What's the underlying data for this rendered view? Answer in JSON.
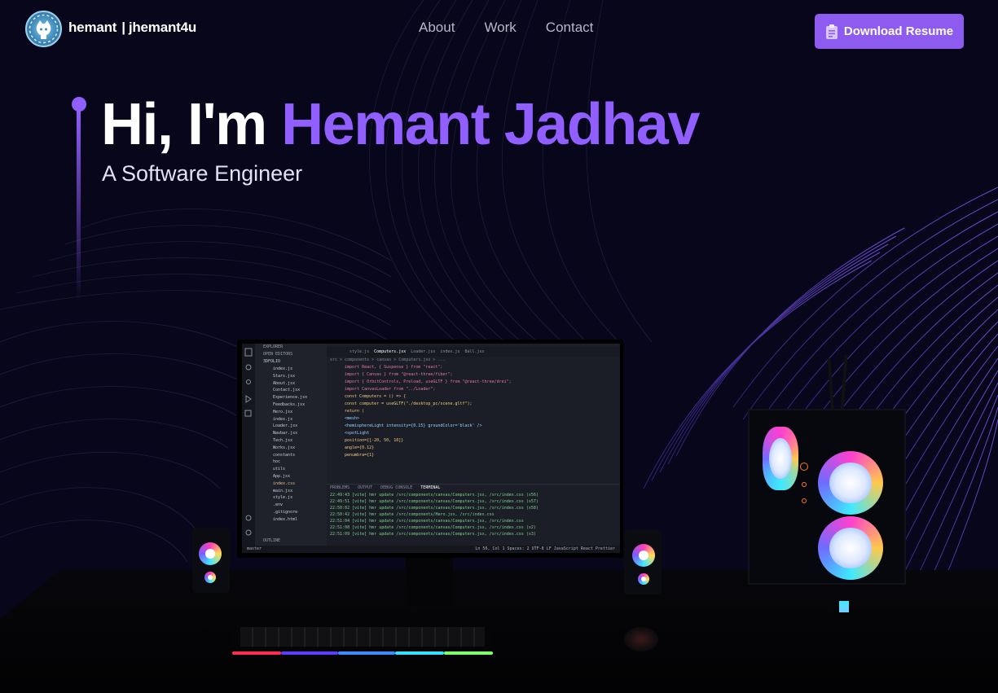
{
  "nav": {
    "brand_name": "hemant",
    "brand_separator": "|",
    "brand_handle": "jhemant4u",
    "links": [
      {
        "label": "About"
      },
      {
        "label": "Work"
      },
      {
        "label": "Contact"
      }
    ],
    "resume_button": "Download Resume",
    "logo_icon": "github-octocat-icon",
    "resume_icon": "clipboard-icon"
  },
  "hero": {
    "greeting": "Hi, I'm",
    "name": "Hemant Jadhav",
    "subtitle": "A Software Engineer"
  },
  "colors": {
    "accent": "#915eff",
    "background": "#07061a",
    "button": "#8d5bf0"
  },
  "monitor_screen": {
    "explorer_title": "EXPLORER",
    "open_editors": "OPEN EDITORS",
    "project": "3DFOLIO",
    "files": [
      "index.js",
      "Stars.jsx",
      "About.jsx",
      "Contact.jsx",
      "Experience.jsx",
      "Feedbacks.jsx",
      "Hero.jsx",
      "index.js",
      "Loader.jsx",
      "Navbar.jsx",
      "Tech.jsx",
      "Works.jsx",
      "constants",
      "hoc",
      "utils",
      "App.jsx",
      "index.css",
      "main.jsx",
      "style.js",
      ".env",
      ".gitignore",
      "index.html"
    ],
    "outline": "OUTLINE",
    "tabs": [
      "style.js",
      "Computers.jsx",
      "Loader.jsx",
      "index.js",
      "Ball.jsx"
    ],
    "breadcrumb": "src > components > canvas > Computers.jsx > ...",
    "code_lines": [
      "import React, { Suspense } from \"react\";",
      "import { Canvas } from \"@react-three/fiber\";",
      "import { OrbitControls, Preload, useGLTF } from \"@react-three/drei\";",
      "",
      "import CanvasLoader from \"../Loader\";",
      "",
      "const Computers = () => {",
      "  const computer = useGLTF(\"./desktop_pc/scene.gltf\");",
      "",
      "  return (",
      "    <mesh>",
      "      <hemisphereLight intensity={0.15} groundColor='black' />",
      "      <spotLight",
      "        position={[-20, 50, 10]}",
      "        angle={0.12}",
      "        penumbra={1}"
    ],
    "panel_tabs": [
      "PROBLEMS",
      "OUTPUT",
      "DEBUG CONSOLE",
      "TERMINAL"
    ],
    "terminal_lines": [
      "22:49:43 [vite] hmr update /src/components/canvas/Computers.jsx, /src/index.css (x56)",
      "22:49:51 [vite] hmr update /src/components/canvas/Computers.jsx, /src/index.css (x57)",
      "22:50:02 [vite] hmr update /src/components/canvas/Computers.jsx, /src/index.css (x58)",
      "22:50:42 [vite] hmr update /src/components/Hero.jsx, /src/index.css",
      "22:51:04 [vite] hmr update /src/components/canvas/Computers.jsx, /src/index.css",
      "22:51:08 [vite] hmr update /src/components/canvas/Computers.jsx, /src/index.css (x2)",
      "22:51:09 [vite] hmr update /src/components/canvas/Computers.jsx, /src/index.css (x3)"
    ],
    "status_left": "master",
    "status_right": "Ln 56, Col 1  Spaces: 2  UTF-8  LF  JavaScript React  Prettier"
  }
}
